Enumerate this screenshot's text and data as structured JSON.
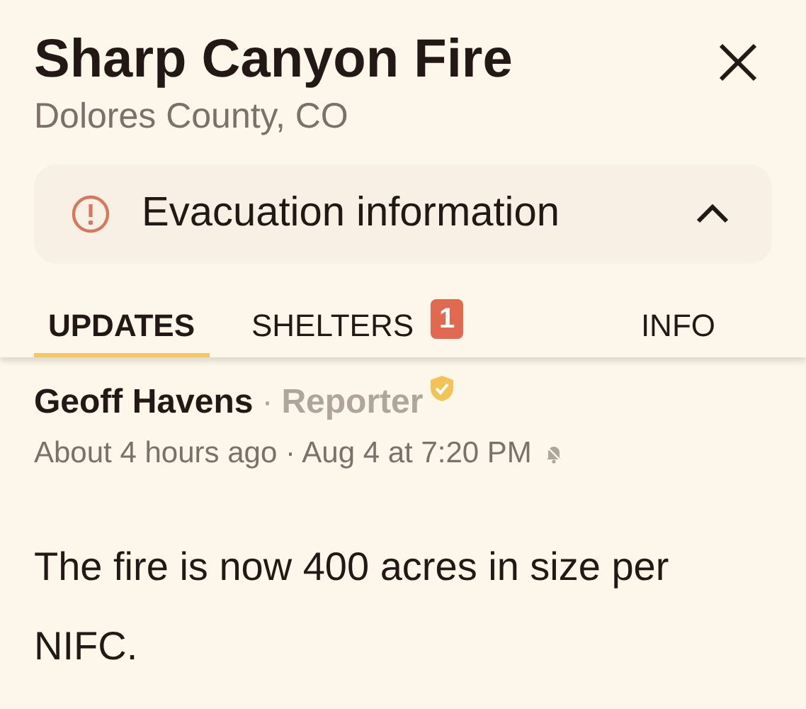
{
  "header": {
    "title": "Sharp Canyon Fire",
    "subtitle": "Dolores County, CO"
  },
  "evacuation": {
    "label": "Evacuation information",
    "expanded": true
  },
  "tabs": [
    {
      "label": "UPDATES",
      "selected": true
    },
    {
      "label": "SHELTERS",
      "selected": false,
      "badge": "1"
    },
    {
      "label": "INFO",
      "selected": false
    }
  ],
  "update": {
    "author": "Geoff Havens",
    "separator": "·",
    "role": "Reporter",
    "verified": true,
    "time": "About 4 hours ago · Aug 4 at 7:20 PM",
    "notifications_muted": true,
    "body": "The fire is now 400 acres in size per NIFC."
  }
}
